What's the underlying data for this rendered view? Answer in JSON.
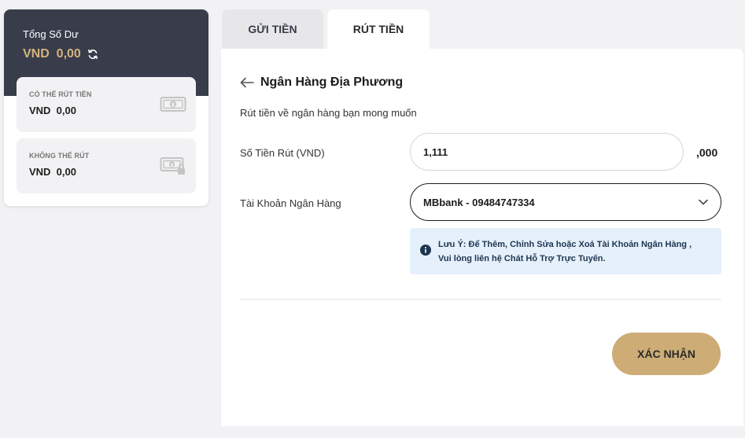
{
  "balance": {
    "title": "Tổng Số Dư",
    "value": "VND  0,00",
    "withdrawable": {
      "label": "CÓ THỂ RÚT TIỀN",
      "value": "VND  0,00"
    },
    "non_withdrawable": {
      "label": "KHÔNG THỂ RÚT",
      "value": "VND  0,00"
    }
  },
  "tabs": [
    {
      "label": "GỬI TIỀN",
      "active": false
    },
    {
      "label": "RÚT TIỀN",
      "active": true
    }
  ],
  "form": {
    "title": "Ngân Hàng Địa Phương",
    "subtitle": "Rút tiền về ngân hàng bạn mong muốn",
    "amount_label": "Số Tiền Rút (VND)",
    "amount_value": "1,111",
    "amount_suffix": ",000",
    "bank_label": "Tài Khoản Ngân Hàng",
    "bank_value": "MBbank - 09484747334",
    "notice_line1": "Lưu Ý: Để Thêm, Chỉnh Sửa hoặc Xoá Tài Khoản Ngân Hàng ,",
    "notice_line2": "Vui lòng liên hệ Chát Hỗ Trợ Trực Tuyến.",
    "confirm_label": "XÁC NHẬN"
  },
  "colors": {
    "accent_gold": "#cdac75",
    "balance_gold": "#d5b47c",
    "dark_header": "#383c4b",
    "notice_bg": "#e5f0fb",
    "notice_icon": "#1e3550"
  },
  "icons": {
    "refresh": "refresh-icon",
    "money": "money-icon",
    "money_lock": "money-lock-icon",
    "back": "arrow-left-icon",
    "chevron": "chevron-down-icon",
    "info": "info-icon"
  }
}
